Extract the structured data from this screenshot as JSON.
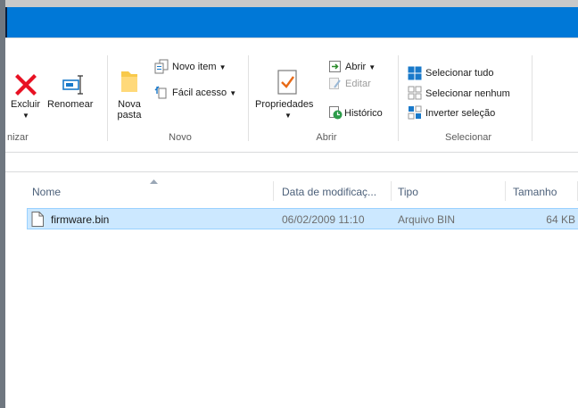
{
  "colors": {
    "title_bar": "#0078d7",
    "selection_bg": "#cce8ff",
    "selection_border": "#99d1ff",
    "header_text": "#4c607a",
    "delete_red": "#e81123",
    "accent_blue": "#1979ca"
  },
  "ribbon": {
    "organize": {
      "delete_label": "Excluir",
      "rename_label": "Renomear",
      "group_label": "nizar"
    },
    "new": {
      "new_folder_line1": "Nova",
      "new_folder_line2": "pasta",
      "new_item_label": "Novo item",
      "easy_access_label": "Fácil acesso",
      "group_label": "Novo"
    },
    "open": {
      "properties_label": "Propriedades",
      "open_label": "Abrir",
      "edit_label": "Editar",
      "history_label": "Histórico",
      "group_label": "Abrir"
    },
    "select": {
      "select_all_label": "Selecionar tudo",
      "select_none_label": "Selecionar nenhum",
      "invert_label": "Inverter seleção",
      "group_label": "Selecionar"
    }
  },
  "columns": {
    "name": "Nome",
    "date": "Data de modificaç...",
    "type": "Tipo",
    "size": "Tamanho"
  },
  "files": [
    {
      "name": "firmware.bin",
      "date": "06/02/2009 11:10",
      "type": "Arquivo BIN",
      "size": "64 KB"
    }
  ]
}
